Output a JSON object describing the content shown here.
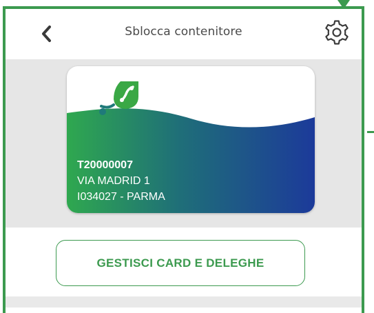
{
  "header": {
    "title": "Sblocca contenitore",
    "back_icon": "chevron-left-icon",
    "settings_icon": "gear-icon"
  },
  "card": {
    "code": "T20000007",
    "address": "VIA MADRID 1",
    "location": "I034027 - PARMA",
    "logo_icon": "leaf-logo-icon"
  },
  "actions": {
    "manage_label": "GESTISCI CARD E DELEGHE"
  },
  "colors": {
    "accent_green": "#3c9a4f",
    "card_gradient_start": "#2fa84f",
    "card_gradient_end": "#1c3a9a",
    "gray_background": "#e6e6e6"
  }
}
